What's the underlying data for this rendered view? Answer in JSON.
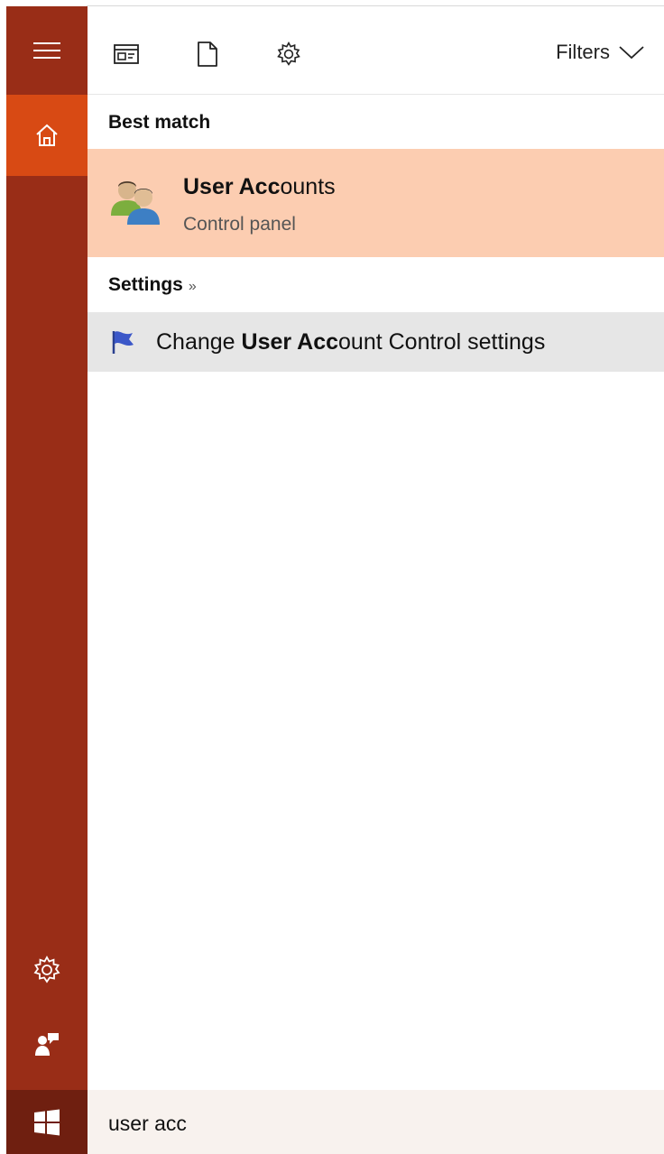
{
  "toolbar": {
    "filters_label": "Filters"
  },
  "sections": {
    "best_match_title": "Best match",
    "settings_title": "Settings",
    "settings_more": "»"
  },
  "best_match": {
    "name_bold": "User Acc",
    "name_rest": "ounts",
    "subtitle": "Control panel"
  },
  "settings_results": [
    {
      "prefix": "Change ",
      "bold": "User Acc",
      "suffix": "ount Control settings"
    }
  ],
  "search": {
    "query": "user acc"
  },
  "colors": {
    "rail": "#992d17",
    "accent": "#d84a14",
    "best_match_bg": "#fccdb1",
    "result_bg": "#e6e6e6",
    "taskbar": "#6f1f10"
  },
  "icons": {
    "menu": "hamburger-icon",
    "home": "home-icon",
    "apps": "apps-icon",
    "documents": "document-icon",
    "settings": "gear-icon",
    "feedback": "feedback-icon",
    "start": "windows-logo-icon",
    "filters": "chevron-down-icon",
    "user_accounts": "user-accounts-icon",
    "uac_flag": "flag-icon"
  }
}
